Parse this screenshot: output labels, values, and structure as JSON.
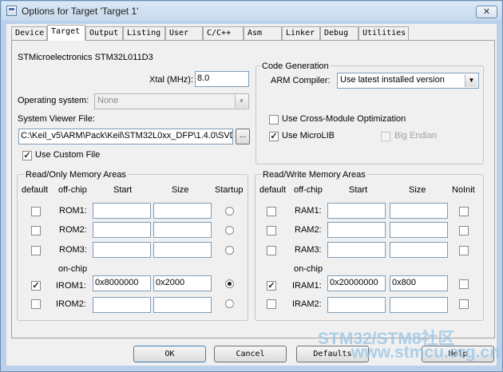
{
  "window": {
    "title": "Options for Target 'Target 1'",
    "close_glyph": "✕"
  },
  "tabs": [
    "Device",
    "Target",
    "Output",
    "Listing",
    "User",
    "C/C++",
    "Asm",
    "Linker",
    "Debug",
    "Utilities"
  ],
  "active_tab": "Target",
  "device_name": "STMicroelectronics STM32L011D3",
  "xtal": {
    "label": "Xtal (MHz):",
    "value": "8.0"
  },
  "operating_system": {
    "label": "Operating system:",
    "value": "None"
  },
  "system_viewer": {
    "label": "System Viewer File:",
    "value": "C:\\Keil_v5\\ARM\\Pack\\Keil\\STM32L0xx_DFP\\1.4.0\\SVD",
    "browse": "..."
  },
  "use_custom_file": {
    "label": "Use Custom File",
    "checked": true
  },
  "code_generation": {
    "title": "Code Generation",
    "arm_compiler_label": "ARM Compiler:",
    "arm_compiler_value": "Use latest installed version",
    "cross_module": {
      "label": "Use Cross-Module Optimization",
      "checked": false
    },
    "microlib": {
      "label": "Use MicroLIB",
      "checked": true
    },
    "big_endian": {
      "label": "Big Endian",
      "checked": false
    }
  },
  "rom_areas": {
    "title": "Read/Only Memory Areas",
    "headers": {
      "default": "default",
      "offchip": "off-chip",
      "start": "Start",
      "size": "Size",
      "startup": "Startup"
    },
    "onchip_label": "on-chip",
    "rows": [
      {
        "name": "ROM1:",
        "default": false,
        "start": "",
        "size": "",
        "startup": false
      },
      {
        "name": "ROM2:",
        "default": false,
        "start": "",
        "size": "",
        "startup": false
      },
      {
        "name": "ROM3:",
        "default": false,
        "start": "",
        "size": "",
        "startup": false
      },
      {
        "name": "IROM1:",
        "default": true,
        "start": "0x8000000",
        "size": "0x2000",
        "startup": true
      },
      {
        "name": "IROM2:",
        "default": false,
        "start": "",
        "size": "",
        "startup": false
      }
    ]
  },
  "ram_areas": {
    "title": "Read/Write Memory Areas",
    "headers": {
      "default": "default",
      "offchip": "off-chip",
      "start": "Start",
      "size": "Size",
      "noinit": "NoInit"
    },
    "onchip_label": "on-chip",
    "rows": [
      {
        "name": "RAM1:",
        "default": false,
        "start": "",
        "size": "",
        "noinit": false
      },
      {
        "name": "RAM2:",
        "default": false,
        "start": "",
        "size": "",
        "noinit": false
      },
      {
        "name": "RAM3:",
        "default": false,
        "start": "",
        "size": "",
        "noinit": false
      },
      {
        "name": "IRAM1:",
        "default": true,
        "start": "0x20000000",
        "size": "0x800",
        "noinit": false
      },
      {
        "name": "IRAM2:",
        "default": false,
        "start": "",
        "size": "",
        "noinit": false
      }
    ]
  },
  "buttons": {
    "ok": "OK",
    "cancel": "Cancel",
    "defaults": "Defaults",
    "help": "Help"
  },
  "watermark": {
    "line1": "STM32/STM8社区",
    "line2": "www.stmcu.org.cn"
  },
  "glyphs": {
    "check": "✓",
    "dropdown": "▼"
  }
}
